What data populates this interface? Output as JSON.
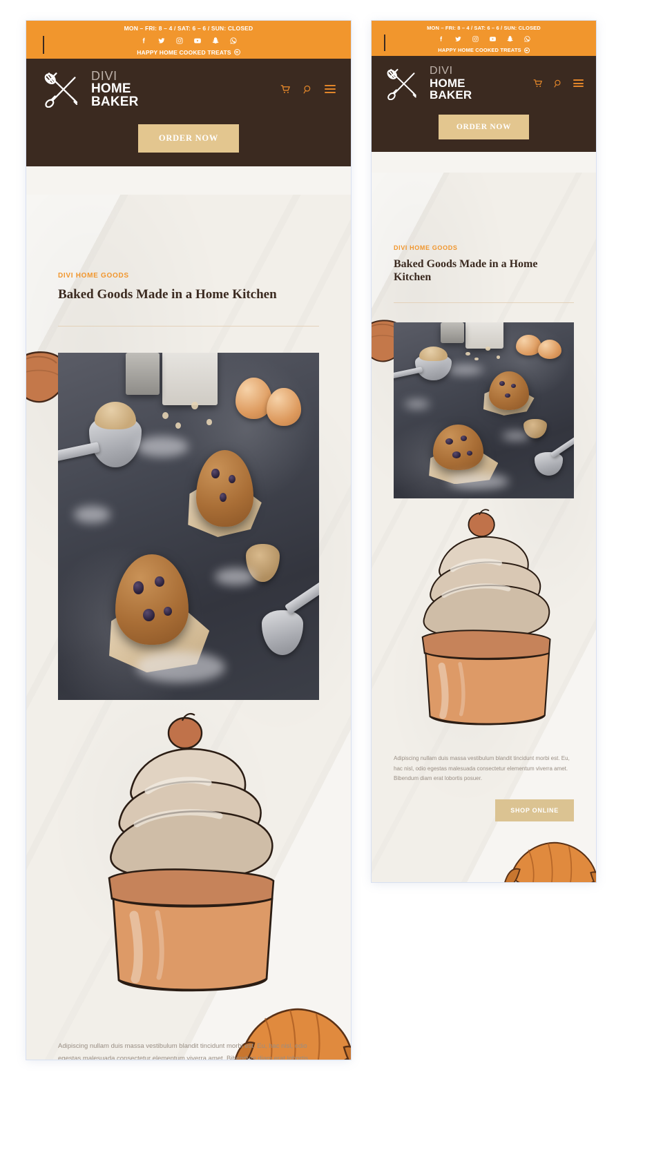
{
  "colors": {
    "orange_bar": "#f1962d",
    "dark_brown": "#3b2a20",
    "tan_button": "#e3c68f",
    "shop_button": "#dbc392",
    "eyebrow_orange": "#f1962d",
    "body_text": "#998e84",
    "page_bg": "#f2efe9",
    "icon_orange": "#e2862a"
  },
  "topbar": {
    "hours": "MON – FRI: 8 – 4 / SAT: 6 – 6 / SUN: CLOSED",
    "tagline": "HAPPY HOME COOKED TREATS",
    "tagline_emoji": "neutral-face-emoji",
    "social": [
      {
        "name": "facebook-icon",
        "label": "Facebook"
      },
      {
        "name": "twitter-icon",
        "label": "Twitter"
      },
      {
        "name": "instagram-icon",
        "label": "Instagram"
      },
      {
        "name": "youtube-icon",
        "label": "YouTube"
      },
      {
        "name": "snapchat-icon",
        "label": "Snapchat"
      },
      {
        "name": "whatsapp-icon",
        "label": "WhatsApp"
      }
    ]
  },
  "header": {
    "logo_mark": "rolling-pin-whisk-icon",
    "brand_line1": "DIVI",
    "brand_line2": "HOME",
    "brand_line3": "BAKER",
    "icons": [
      {
        "name": "cart-icon",
        "label": "Cart"
      },
      {
        "name": "search-icon",
        "label": "Search"
      },
      {
        "name": "hamburger-menu-icon",
        "label": "Menu"
      }
    ],
    "order_button": "ORDER NOW"
  },
  "main": {
    "eyebrow": "DIVI HOME GOODS",
    "headline": "Baked Goods Made in a Home Kitchen",
    "photo_alt": "blueberry-muffins-on-parchment-photo",
    "illustration_alt": "watercolor-cupcake-illustration",
    "body": "Adipiscing nullam duis massa vestibulum blandit tincidunt morbi est. Eu, hac nisl, odio egestas malesuada consectetur elementum viverra amet. Bibendum diam erat lobortis posuer.",
    "shop_button": "SHOP ONLINE",
    "decor_croissant": "croissant-illustration",
    "decor_bread": "bread-loaf-illustration"
  },
  "views": {
    "desktop_label": "desktop-preview",
    "mobile_label": "mobile-preview"
  }
}
